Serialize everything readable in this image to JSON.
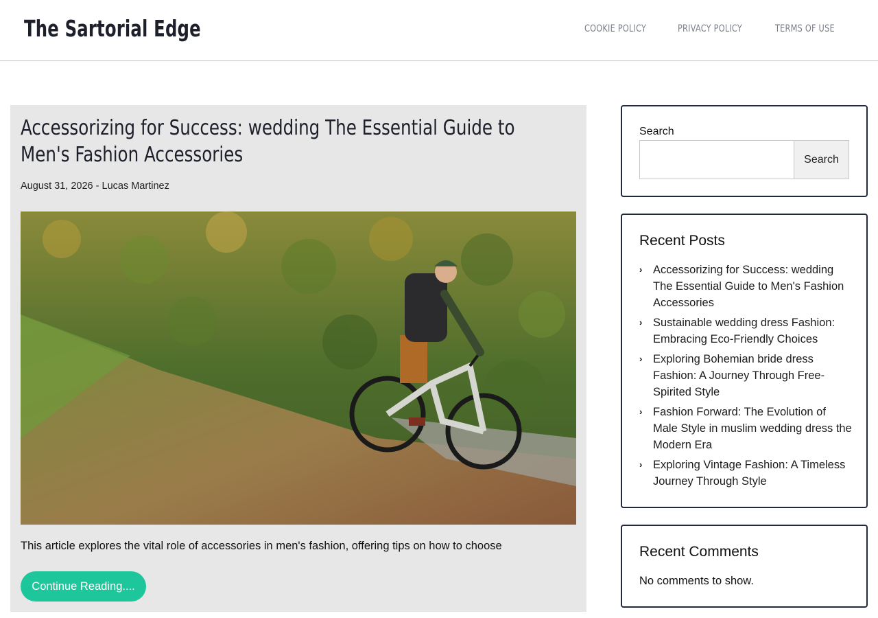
{
  "site": {
    "title": "The Sartorial Edge"
  },
  "nav": {
    "items": [
      {
        "label": "COOKIE POLICY"
      },
      {
        "label": "PRIVACY POLICY"
      },
      {
        "label": "TERMS OF USE"
      }
    ]
  },
  "article": {
    "title": "Accessorizing for Success: wedding The Essential Guide to Men's Fashion Accessories",
    "meta": "August 31, 2026 - Lucas Martinez",
    "excerpt": "This article explores the vital role of accessories in men's fashion, offering tips on how to choose",
    "continue_label": "Continue Reading...."
  },
  "sidebar": {
    "search": {
      "label": "Search",
      "value": "",
      "button_label": "Search"
    },
    "recent_posts": {
      "heading": "Recent Posts",
      "items": [
        {
          "label": "Accessorizing for Success: wedding The Essential Guide to Men's Fashion Accessories"
        },
        {
          "label": "Sustainable wedding dress Fashion: Embracing Eco-Friendly Choices"
        },
        {
          "label": "Exploring Bohemian bride dress Fashion: A Journey Through Free-Spirited Style"
        },
        {
          "label": "Fashion Forward: The Evolution of Male Style in muslim wedding dress the Modern Era"
        },
        {
          "label": "Exploring Vintage Fashion: A Timeless Journey Through Style"
        }
      ]
    },
    "recent_comments": {
      "heading": "Recent Comments",
      "empty_text": "No comments to show."
    }
  },
  "colors": {
    "accent": "#1ec79b",
    "card_bg": "#e7e7e7",
    "widget_border": "#1f2a3c"
  }
}
